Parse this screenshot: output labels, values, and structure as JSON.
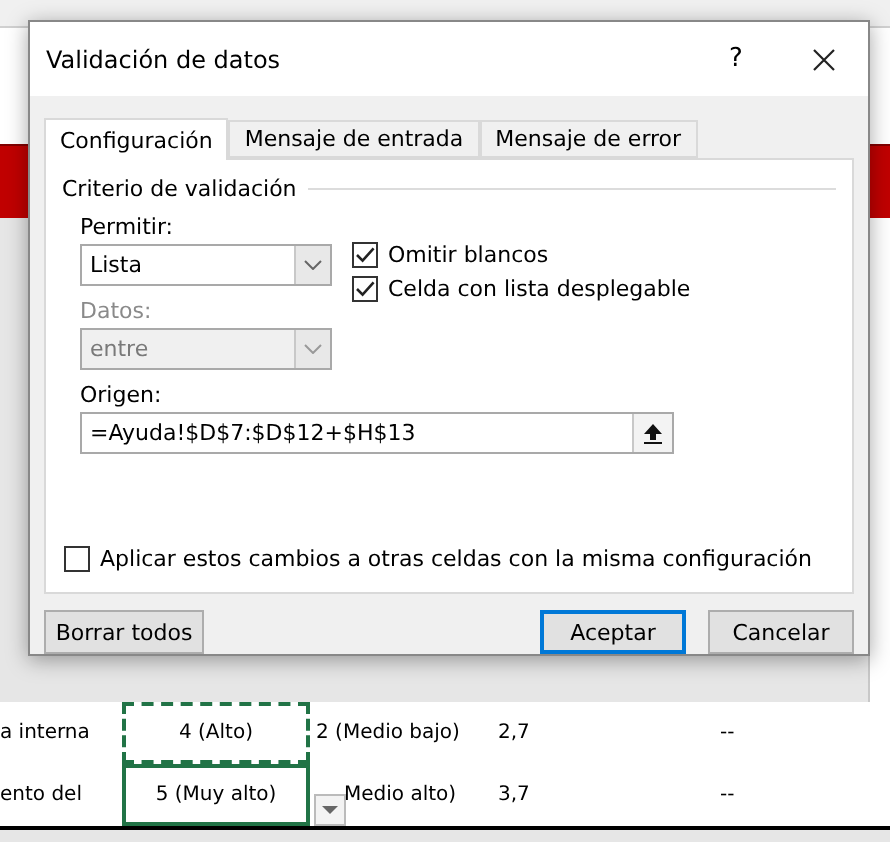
{
  "dialog": {
    "title": "Validación de datos",
    "help": "?",
    "tabs": [
      {
        "label": "Configuración",
        "selected": true
      },
      {
        "label": "Mensaje de entrada",
        "selected": false
      },
      {
        "label": "Mensaje de error",
        "selected": false
      }
    ],
    "section_title": "Criterio de validación",
    "allow": {
      "label": "Permitir:",
      "value": "Lista",
      "disabled": false
    },
    "data": {
      "label": "Datos:",
      "value": "entre",
      "disabled": true
    },
    "checkboxes": [
      {
        "label": "Omitir blancos",
        "checked": true
      },
      {
        "label": "Celda con lista desplegable",
        "checked": true
      }
    ],
    "source": {
      "label": "Origen:",
      "value": "=Ayuda!$D$7:$D$12+$H$13"
    },
    "apply_all": {
      "label": "Aplicar estos cambios a otras celdas con la misma configuración",
      "checked": false
    },
    "buttons": [
      {
        "label": "Borrar todos",
        "kind": "plain"
      },
      {
        "label": "Aceptar",
        "kind": "default"
      },
      {
        "label": "Cancelar",
        "kind": "plain"
      }
    ]
  },
  "sheet": {
    "rows": [
      {
        "kind": "copied",
        "cells": [
          "a interna",
          "4 (Alto)",
          "2 (Medio bajo)",
          "2,7",
          "--"
        ]
      },
      {
        "kind": "active",
        "cells": [
          "ento del",
          "5 (Muy alto)",
          "Medio alto)",
          "3,7",
          "--"
        ]
      }
    ]
  }
}
